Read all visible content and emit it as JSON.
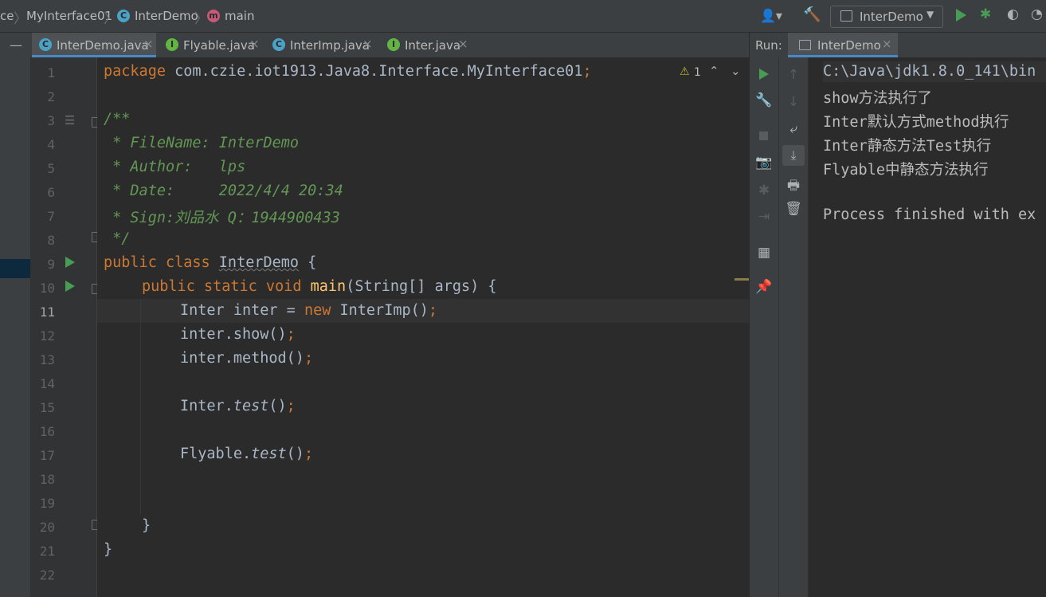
{
  "breadcrumb": [
    {
      "label": "ce"
    },
    {
      "label": "MyInterface01"
    },
    {
      "label": "InterDemo",
      "icon": "class-icon"
    },
    {
      "label": "main",
      "icon": "method-icon"
    }
  ],
  "toolbar": {
    "run_config": "InterDemo"
  },
  "tabs": [
    {
      "label": "InterDemo.java",
      "icon": "C",
      "active": true
    },
    {
      "label": "Flyable.java",
      "icon": "I"
    },
    {
      "label": "InterImp.java",
      "icon": "C"
    },
    {
      "label": "Inter.java",
      "icon": "I"
    }
  ],
  "editor": {
    "line_numbers": [
      "1",
      "2",
      "3",
      "4",
      "5",
      "6",
      "7",
      "8",
      "9",
      "10",
      "11",
      "12",
      "13",
      "14",
      "15",
      "16",
      "17",
      "18",
      "19",
      "20",
      "21",
      "22"
    ],
    "current_line": "11",
    "warning_count": "1",
    "lines": {
      "l1_kw": "package",
      "l1_rest": " com.czie.iot1913.Java8.Interface.MyInterface01",
      "l1_semi": ";",
      "l3": "/**",
      "l4": " * FileName: InterDemo",
      "l5": " * Author:   lps",
      "l6": " * Date:     2022/4/4 20:34",
      "l7": " * Sign:刘品水 Q：1944900433",
      "l8": " */",
      "l9_kw": "public class ",
      "l9_cls": "InterDemo",
      "l9_rest": " {",
      "l10_kw": "public static void ",
      "l10_fn": "main",
      "l10_rest": "(String[] args) {",
      "l11_a": "Inter inter = ",
      "l11_kw": "new ",
      "l11_b": "InterImp()",
      "l11_semi": ";",
      "l12_a": "inter.show()",
      "l12_semi": ";",
      "l13_a": "inter.method()",
      "l13_semi": ";",
      "l15_a": "Inter.",
      "l15_it": "test",
      "l15_b": "()",
      "l15_semi": ";",
      "l17_a": "Flyable.",
      "l17_it": "test",
      "l17_b": "()",
      "l17_semi": ";",
      "l20": "}",
      "l21": "}"
    }
  },
  "run_panel": {
    "label": "Run:",
    "tab": "InterDemo",
    "output": [
      "C:\\Java\\jdk1.8.0_141\\bin",
      "show方法执行了",
      "Inter默认方式method执行",
      "Inter静态方法Test执行",
      "Flyable中静态方法执行",
      "",
      "Process finished with ex"
    ]
  },
  "colors": {
    "keyword": "#cc7832",
    "function": "#ffc66d",
    "doc_comment": "#629755",
    "plain": "#a9b7c6",
    "run_green": "#499c54"
  }
}
